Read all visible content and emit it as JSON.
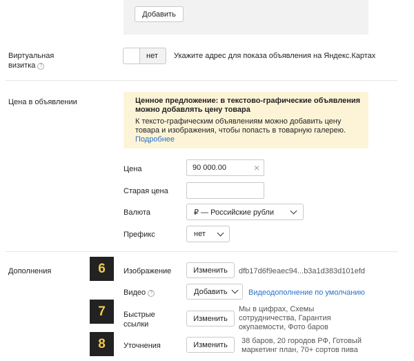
{
  "top": {
    "add_button": "Добавить"
  },
  "vcard": {
    "label_line1": "Виртуальная",
    "label_line2": "визитка",
    "toggle_value": "нет",
    "hint": "Укажите адрес для показа объявления на Яндекс.Картах"
  },
  "price_section": {
    "label": "Цена в объявлении",
    "notice_title_line1": "Ценное предложение: в текстово-графические объявления",
    "notice_title_line2": "можно добавлять цену товара",
    "notice_body_line1": "К тексто-графическим объявлениям можно добавить цену",
    "notice_body_line2": "товара и изображения, чтобы попасть в товарную галерею.",
    "notice_link": "Подробнее",
    "price_label": "Цена",
    "price_value": "90 000.00",
    "clear_icon": "×",
    "old_price_label": "Старая цена",
    "old_price_value": "",
    "currency_label": "Валюта",
    "currency_value": "₽ — Российские рубли",
    "prefix_label": "Префикс",
    "prefix_value": "нет"
  },
  "extras": {
    "label": "Дополнения",
    "badges": [
      "6",
      "7",
      "8"
    ],
    "image_label": "Изображение",
    "image_button": "Изменить",
    "image_value": "dfb17d6f9eaec94...b3a1d383d101efd",
    "video_label": "Видео",
    "video_button": "Добавить",
    "video_link": "Видеодополнение по умолчанию",
    "sitelinks_label_line1": "Быстрые",
    "sitelinks_label_line2": "ссылки",
    "sitelinks_button": "Изменить",
    "sitelinks_value_line1": "Мы в цифрах, Схемы",
    "sitelinks_value_line2": "сотрудничества, Гарантия",
    "sitelinks_value_line3": "окупаемости, Фото баров",
    "callouts_label": "Уточнения",
    "callouts_button": "Изменить",
    "callouts_value_line1": "38 баров, 20 городов РФ, Готовый",
    "callouts_value_line2": "маркетинг план, 70+ сортов пива"
  },
  "colors": {
    "notice_bg": "#fdf4d8",
    "badge_bg": "#222222",
    "badge_fg": "#f2c94c",
    "link": "#2a6fc9"
  }
}
